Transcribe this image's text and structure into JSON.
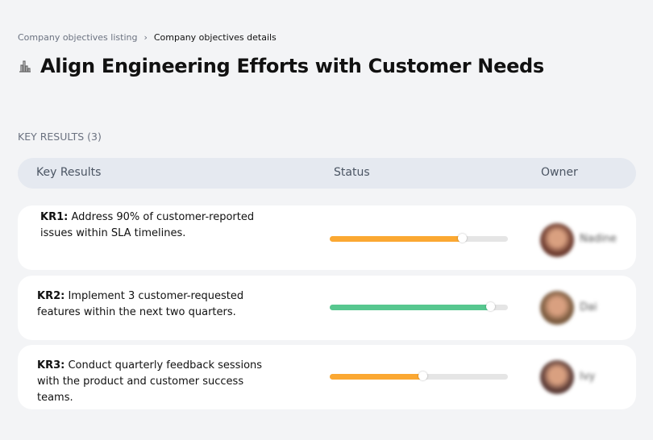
{
  "breadcrumb": {
    "parent": "Company objectives listing",
    "separator": "›",
    "current": "Company objectives details"
  },
  "page": {
    "title": "Align Engineering Efforts with Customer Needs",
    "icon": "chart-building-icon"
  },
  "section": {
    "label": "KEY RESULTS (3)"
  },
  "table": {
    "headers": [
      "Key Results",
      "Status",
      "Owner"
    ]
  },
  "rows": [
    {
      "id": "KR1:",
      "text": "Address 90% of customer-reported issues within SLA timelines.",
      "progress": 74,
      "color": "#fba832",
      "owner": "Nadine",
      "avatar_color": "#6b3a2e"
    },
    {
      "id": "KR2:",
      "text": "Implement 3 customer-requested features within the next two quarters.",
      "progress": 90,
      "color": "#57c78f",
      "owner": "Dai",
      "avatar_color": "#7a5a3e"
    },
    {
      "id": "KR3:",
      "text": "Conduct quarterly feedback sessions with the product and customer success teams.",
      "progress": 52,
      "color": "#fba832",
      "owner": "Ivy",
      "avatar_color": "#5a3a35"
    }
  ]
}
